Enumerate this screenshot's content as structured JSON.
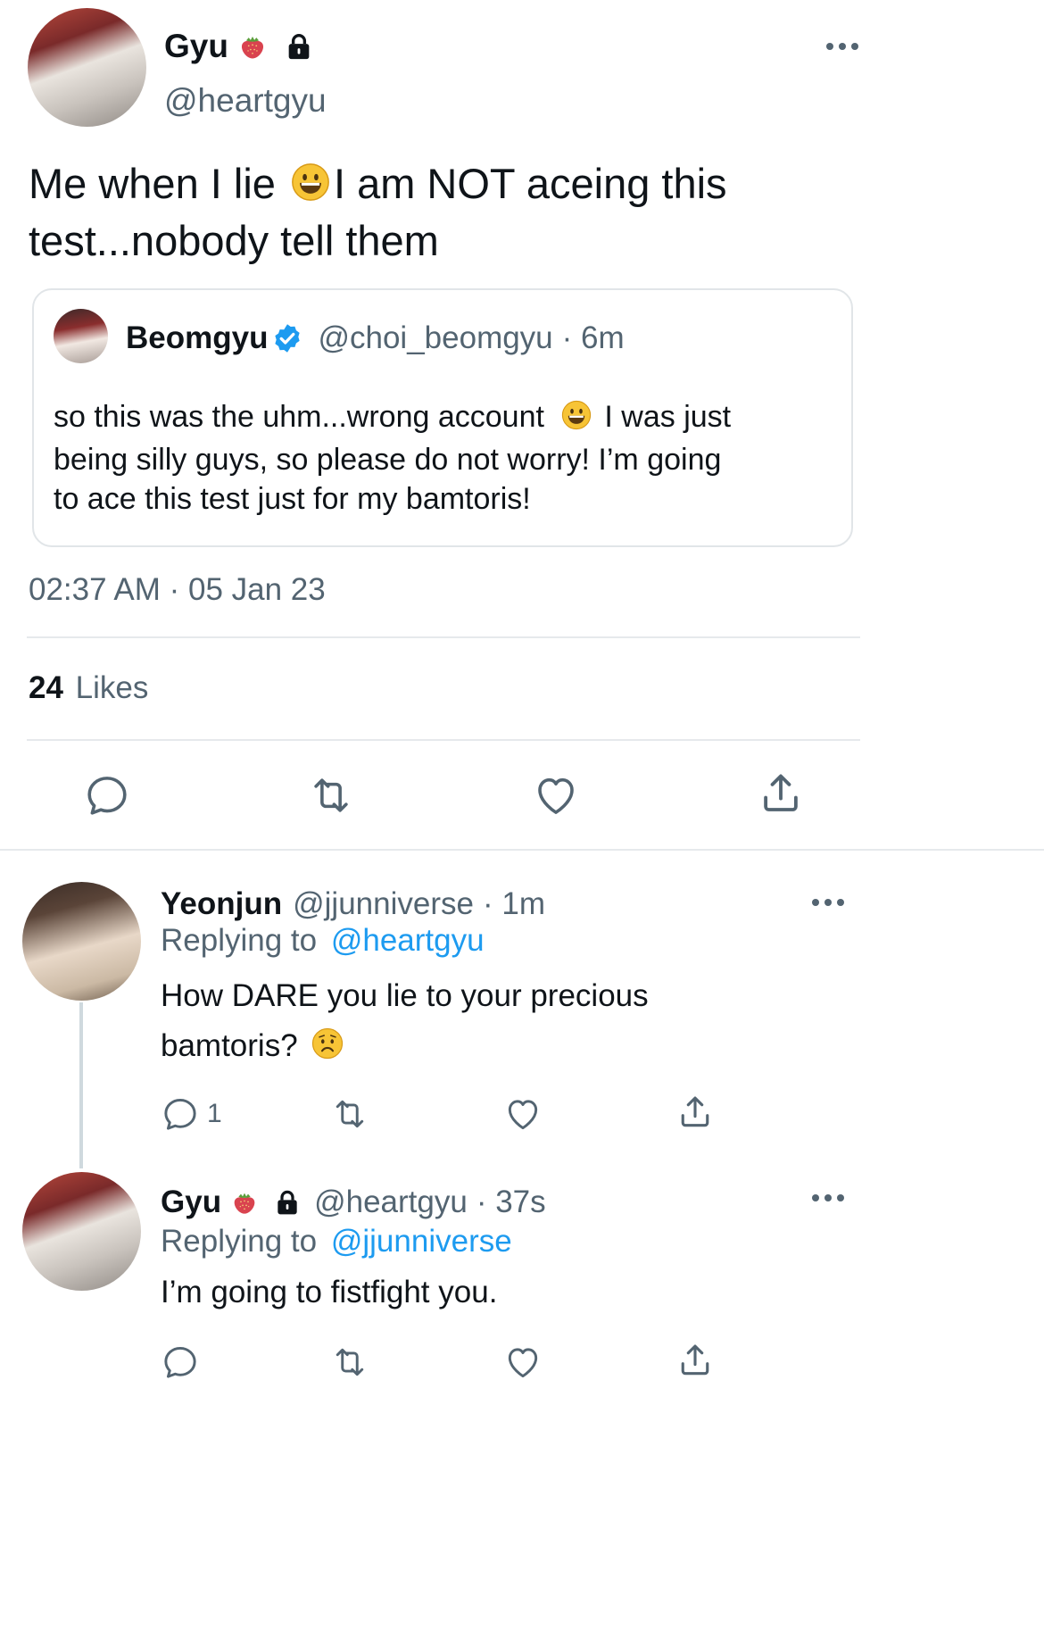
{
  "main_tweet": {
    "author_name": "Gyu",
    "name_emoji": "strawberry-icon",
    "lock": "lock-icon",
    "handle": "@heartgyu",
    "text_part1": "Me when I lie",
    "text_part2": "I am NOT aceing this",
    "text_line2": "test...nobody tell them",
    "timestamp": "02:37 AM · 05 Jan 23",
    "likes_count": "24",
    "likes_label": "Likes"
  },
  "quoted_tweet": {
    "author_name": "Beomgyu",
    "verified": "verified-badge-icon",
    "handle": "@choi_beomgyu",
    "time": "· 6m",
    "line1_a": "so this was the uhm...wrong account",
    "line1_b": "I was just",
    "line2": "being silly guys, so please do not worry! I’m going",
    "line3": "to ace this test just for my bamtoris!"
  },
  "replies": [
    {
      "author_name": "Yeonjun",
      "handle": "@jjunniverse",
      "time": "· 1m",
      "replying_prefix": "Replying to",
      "replying_to": "@heartgyu",
      "text_line1": "How DARE you lie to your precious",
      "text_line2": "bamtoris?",
      "reply_count": "1"
    },
    {
      "author_name": "Gyu",
      "handle": "@heartgyu",
      "time": "· 37s",
      "replying_prefix": "Replying to",
      "replying_to": "@jjunniverse",
      "text_line1": "I’m going to fistfight you.",
      "reply_count": ""
    }
  ],
  "colors": {
    "accent": "#1d9bf0",
    "secondary_text": "#536471",
    "divider": "#e6e9ec"
  }
}
